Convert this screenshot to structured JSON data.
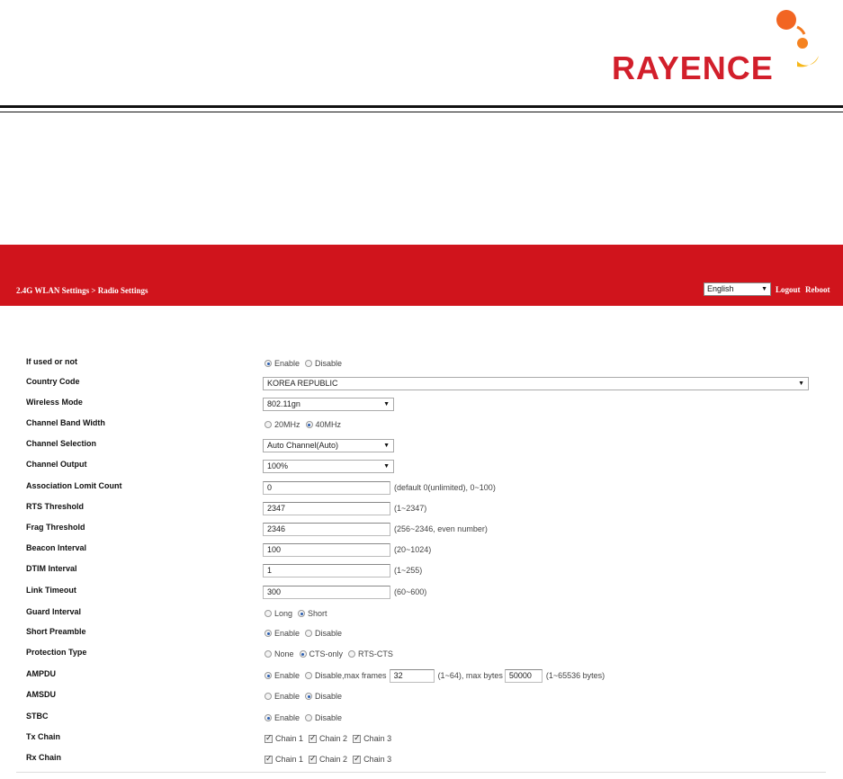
{
  "brand": {
    "logo_text": "RAYENCE",
    "colors": {
      "logo_red": "#d21f2b",
      "logo_orange": "#f58220",
      "logo_yellow": "#f6b719",
      "topbar": "#d0141c"
    }
  },
  "header": {
    "breadcrumb": "2.4G WLAN Settings > Radio Settings",
    "language": "English",
    "logout": "Logout",
    "reboot": "Reboot"
  },
  "settings": {
    "if_used": {
      "label": "If used or not",
      "opt1": "Enable",
      "opt2": "Disable",
      "selected": "Enable"
    },
    "country": {
      "label": "Country Code",
      "value": "KOREA REPUBLIC"
    },
    "wireless_mode": {
      "label": "Wireless Mode",
      "value": "802.11gn"
    },
    "band_width": {
      "label": "Channel Band Width",
      "opt1": "20MHz",
      "opt2": "40MHz",
      "selected": "40MHz"
    },
    "channel_selection": {
      "label": "Channel Selection",
      "value": "Auto Channel(Auto)"
    },
    "channel_output": {
      "label": "Channel Output",
      "value": "100%"
    },
    "assoc_limit": {
      "label": "Association Lomit Count",
      "value": "0",
      "hint": "(default 0(unlimited), 0~100)"
    },
    "rts": {
      "label": "RTS Threshold",
      "value": "2347",
      "hint": "(1~2347)"
    },
    "frag": {
      "label": "Frag Threshold",
      "value": "2346",
      "hint": "(256~2346, even number)"
    },
    "beacon": {
      "label": "Beacon Interval",
      "value": "100",
      "hint": "(20~1024)"
    },
    "dtim": {
      "label": "DTIM Interval",
      "value": "1",
      "hint": "(1~255)"
    },
    "link_timeout": {
      "label": "Link Timeout",
      "value": "300",
      "hint": "(60~600)"
    },
    "guard": {
      "label": "Guard Interval",
      "opt1": "Long",
      "opt2": "Short",
      "selected": "Short"
    },
    "preamble": {
      "label": "Short Preamble",
      "opt1": "Enable",
      "opt2": "Disable",
      "selected": "Enable"
    },
    "protection": {
      "label": "Protection Type",
      "opt1": "None",
      "opt2": "CTS-only",
      "opt3": "RTS-CTS",
      "selected": "CTS-only"
    },
    "ampdu": {
      "label": "AMPDU",
      "opt1": "Enable",
      "opt2": "Disable",
      "selected": "Enable",
      "frames_label": ",max frames",
      "frames_value": "32",
      "frames_hint": "(1~64), max bytes",
      "bytes_value": "50000",
      "bytes_hint": "(1~65536 bytes)"
    },
    "amsdu": {
      "label": "AMSDU",
      "opt1": "Enable",
      "opt2": "Disable",
      "selected": "Disable"
    },
    "stbc": {
      "label": "STBC",
      "opt1": "Enable",
      "opt2": "Disable",
      "selected": "Enable"
    },
    "tx_chain": {
      "label": "Tx Chain",
      "c1": "Chain 1",
      "c2": "Chain 2",
      "c3": "Chain 3"
    },
    "rx_chain": {
      "label": "Rx Chain",
      "c1": "Chain 1",
      "c2": "Chain 2",
      "c3": "Chain 3"
    }
  }
}
